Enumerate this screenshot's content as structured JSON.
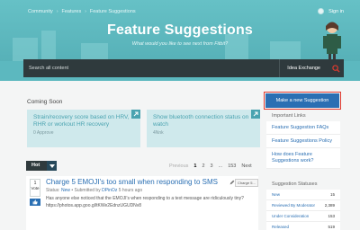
{
  "breadcrumb": [
    "Community",
    "Features",
    "Feature Suggestions"
  ],
  "user": {
    "label": "Sign in"
  },
  "banner": {
    "title": "Feature Suggestions",
    "tagline": "What would you like to see next from Fitbit?"
  },
  "search": {
    "placeholder": "Search all content",
    "scope": "Idea Exchange"
  },
  "coming_soon": {
    "heading": "Coming Soon",
    "cards": [
      {
        "title": "Strain/recovery score based on HRV, RHR or workout HR recovery",
        "meta": "0 Approve"
      },
      {
        "title": "Show bluetooth connection status on watch",
        "meta": "4Nnk"
      }
    ]
  },
  "make_button": "Make a new Suggestion",
  "important_links": {
    "heading": "Important Links",
    "items": [
      "Feature Suggestion FAQs",
      "Feature Suggestions Policy",
      "How does Feature Suggestions work?"
    ]
  },
  "statuses": {
    "heading": "Suggestion Statuses",
    "rows": [
      {
        "label": "New",
        "count": "15"
      },
      {
        "label": "Reviewed By Moderator",
        "count": "2,389"
      },
      {
        "label": "Under Consideration",
        "count": "153"
      },
      {
        "label": "Released",
        "count": "519"
      }
    ]
  },
  "sort": {
    "label": "Hot"
  },
  "pager": {
    "prev": "Previous",
    "pages": [
      "1",
      "2",
      "3"
    ],
    "ellipsis": "...",
    "last": "153",
    "next": "Next"
  },
  "post": {
    "votes": "1",
    "votes_label": "Vote",
    "title": "Charge 5 EMOJI's too small when responding to SMS",
    "tag": "Charge 5...",
    "status_label": "Status:",
    "status": "New",
    "submitted": "Submitted by",
    "author": "DPinOz",
    "time": "5 hours ago",
    "comments": "Comment",
    "body": "Has anyone else noticed that the EMOJI's when responding to a text message are ridiculously tiny?https://photos.app.goo.gl/tKWe2EdnzUGUDNv8"
  },
  "colors": {
    "banner": "#5cb8bf",
    "accent": "#2a6fb3",
    "card": "#cfe9ec",
    "highlight": "#e03a2f"
  },
  "icons": {
    "search": "magnifier-icon",
    "like": "thumbs-up-icon",
    "corner": "badge-corner-icon"
  }
}
